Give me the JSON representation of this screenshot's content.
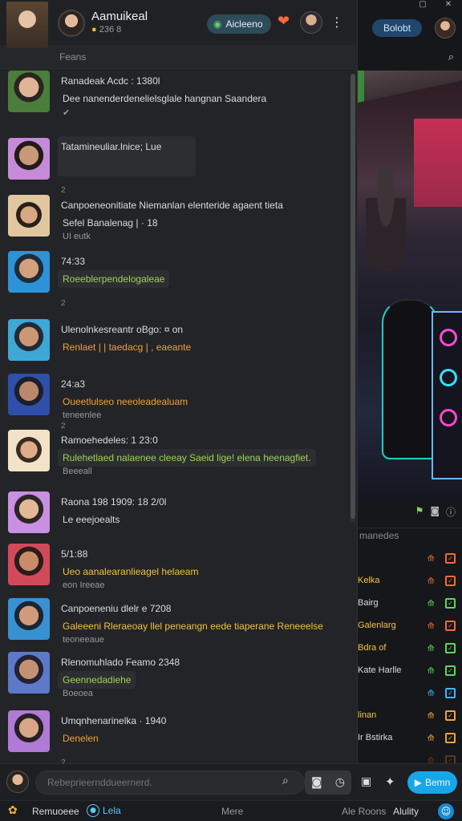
{
  "window": {
    "minimize_icon": "square-icon",
    "close_icon": "close-icon"
  },
  "header": {
    "group_name": "Aamuikeal",
    "meta_count": "236",
    "meta_suffix": "8",
    "chip_label": "Aicleeno",
    "react_icon": "heart-icon",
    "more_icon": "kebab-icon"
  },
  "search": {
    "placeholder": "Feans"
  },
  "stream": {
    "follow_label": "Bolobt",
    "side_title": "manedes",
    "side_items": [
      {
        "label": "",
        "icon_color": "#f06a3a",
        "box_color": "#f06a3a"
      },
      {
        "label": "Kelka",
        "icon_color": "#f06a3a",
        "box_color": "#f06a3a"
      },
      {
        "label": "Bairg",
        "icon_color": "#5cd65c",
        "box_color": "#5cd65c"
      },
      {
        "label": "Galenlarg",
        "icon_color": "#f06a3a",
        "box_color": "#f06a3a"
      },
      {
        "label": "Bdra of",
        "icon_color": "#5cd65c",
        "box_color": "#5cd65c"
      },
      {
        "label": "Kate Harlle",
        "icon_color": "#5cd65c",
        "box_color": "#5cd65c"
      },
      {
        "label": "",
        "icon_color": "#38b6ff",
        "box_color": "#38b6ff"
      },
      {
        "label": "linan",
        "icon_color": "#f0a23a",
        "box_color": "#f0a23a"
      },
      {
        "label": "Ir Bstirka",
        "icon_color": "#f0a23a",
        "box_color": "#f0a23a"
      },
      {
        "label": "",
        "icon_color": "#5a3a20",
        "box_color": "#5a3a20"
      }
    ]
  },
  "messages": [
    {
      "name": "Ranadeak Acdc : 1380l",
      "body": "Dee nanenderdenelielsglale hangnan Saandera",
      "line2": "✔",
      "tick": "",
      "body_color": "c-white",
      "bubble": false,
      "avatar": "av-a"
    },
    {
      "name": "Tatamineuliar.lnice; Lue",
      "body": "",
      "line2": "",
      "tick": "2",
      "body_color": "c-white",
      "bubble": true,
      "avatar": "av-b"
    },
    {
      "name": "Canpoeneonitiate Niemanlan elenteride agaent tieta",
      "body": "Sefel Banalenag | · 18",
      "line2": "UI eutk",
      "tick": "",
      "body_color": "c-white",
      "bubble": false,
      "avatar": "av-c"
    },
    {
      "name": "74:33",
      "body": "Roeeblerpendelogaleae",
      "line2": "",
      "tick": "2",
      "body_color": "c-green",
      "bubble": true,
      "avatar": "av-d"
    },
    {
      "name": "Ulenolnkesreantr oBgo: ¤ on",
      "body": "Renlaet | | taedacg | , eaeante",
      "line2": "",
      "tick": "",
      "body_color": "c-orange",
      "bubble": false,
      "avatar": "av-e"
    },
    {
      "name": "24:a3",
      "body": "Oueetlulseo neeoleadealuam",
      "line2": "teneenlee",
      "tick": "2",
      "body_color": "c-orange",
      "bubble": false,
      "avatar": "av-f"
    },
    {
      "name": "Ramoehedeles: 1 23:0",
      "body": "Rulehetlaed nalaenee cleeay Saeid lige! elena heenagfiet.",
      "line2": "Beeeall",
      "tick": "",
      "body_color": "c-green",
      "bubble": true,
      "avatar": "av-g"
    },
    {
      "name": "Raona 198 1909: 18 2/0l",
      "body": "Le eeejoealts",
      "line2": "",
      "tick": "",
      "body_color": "c-white",
      "bubble": false,
      "avatar": "av-h"
    },
    {
      "name": "5/1:88",
      "body": "Ueo aanalearanlieagel helaeam",
      "line2": "eon Ireeae",
      "tick": "",
      "body_color": "c-yellow",
      "bubble": false,
      "avatar": "av-i"
    },
    {
      "name": "Canpoeneniu dlelr e 7208",
      "body": "Galeeeni Rleraeoay llel peneangn eede tiaperane Reneeelse",
      "line2": "teoneeaue",
      "tick": "",
      "body_color": "c-yellow",
      "bubble": false,
      "avatar": "av-j"
    },
    {
      "name": "Rlenomuhlado Feamo 2348",
      "body": "Geennedadiehe",
      "line2": "Boeoea",
      "tick": "",
      "body_color": "c-green",
      "bubble": true,
      "avatar": "av-k"
    },
    {
      "name": "Umqnhenarinelka · 1940",
      "body": "Denelen",
      "line2": "",
      "tick": "2",
      "body_color": "c-orange",
      "bubble": false,
      "avatar": "av-l"
    }
  ],
  "composer": {
    "placeholder": "Rebeprieernddueernerd.",
    "send_label": "Bemn"
  },
  "nav": {
    "home": "Remuoeee",
    "live": "Lela",
    "live_badge": "●",
    "more": "Mere",
    "alerts": "Ale Roons",
    "activity": "Alulity"
  }
}
